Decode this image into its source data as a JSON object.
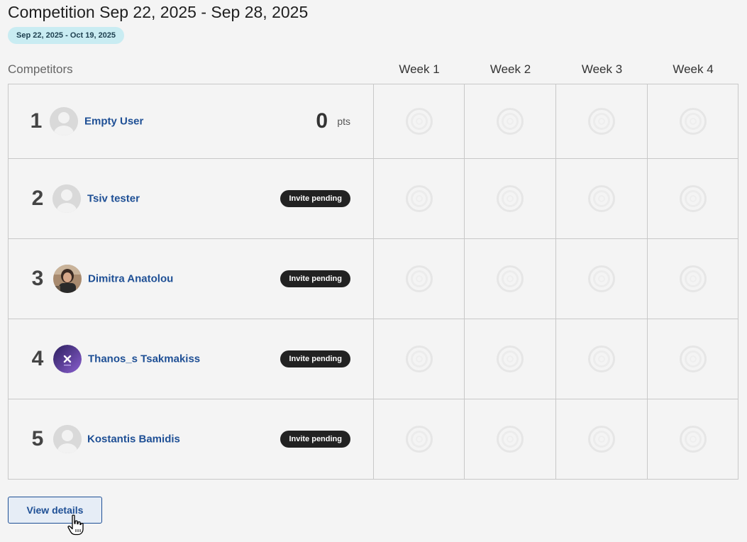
{
  "page": {
    "title": "Competition Sep 22, 2025 - Sep 28, 2025",
    "date_range_badge": "Sep 22, 2025 - Oct 19, 2025"
  },
  "table": {
    "competitors_header": "Competitors",
    "weeks": [
      "Week 1",
      "Week 2",
      "Week 3",
      "Week 4"
    ],
    "rows": [
      {
        "rank": "1",
        "name": "Empty User",
        "avatar": "default-avatar",
        "points": "0",
        "points_label": "pts",
        "status": ""
      },
      {
        "rank": "2",
        "name": "Tsiv tester",
        "avatar": "default-avatar",
        "points": "",
        "points_label": "",
        "status": "Invite pending"
      },
      {
        "rank": "3",
        "name": "Dimitra Anatolou",
        "avatar": "photo-avatar",
        "points": "",
        "points_label": "",
        "status": "Invite pending"
      },
      {
        "rank": "4",
        "name": "Thanos_s Tsakmakiss",
        "avatar": "logo-avatar",
        "points": "",
        "points_label": "",
        "status": "Invite pending"
      },
      {
        "rank": "5",
        "name": "Kostantis Bamidis",
        "avatar": "default-avatar",
        "points": "",
        "points_label": "",
        "status": "Invite pending"
      }
    ],
    "week_cell_icon": "empty-progress-ring-icon"
  },
  "actions": {
    "view_details_label": "View details"
  },
  "colors": {
    "link": "#1e4f95",
    "badge_bg": "#c9ecf2",
    "pending_bg": "#222222",
    "page_bg": "#f4f4f4"
  }
}
